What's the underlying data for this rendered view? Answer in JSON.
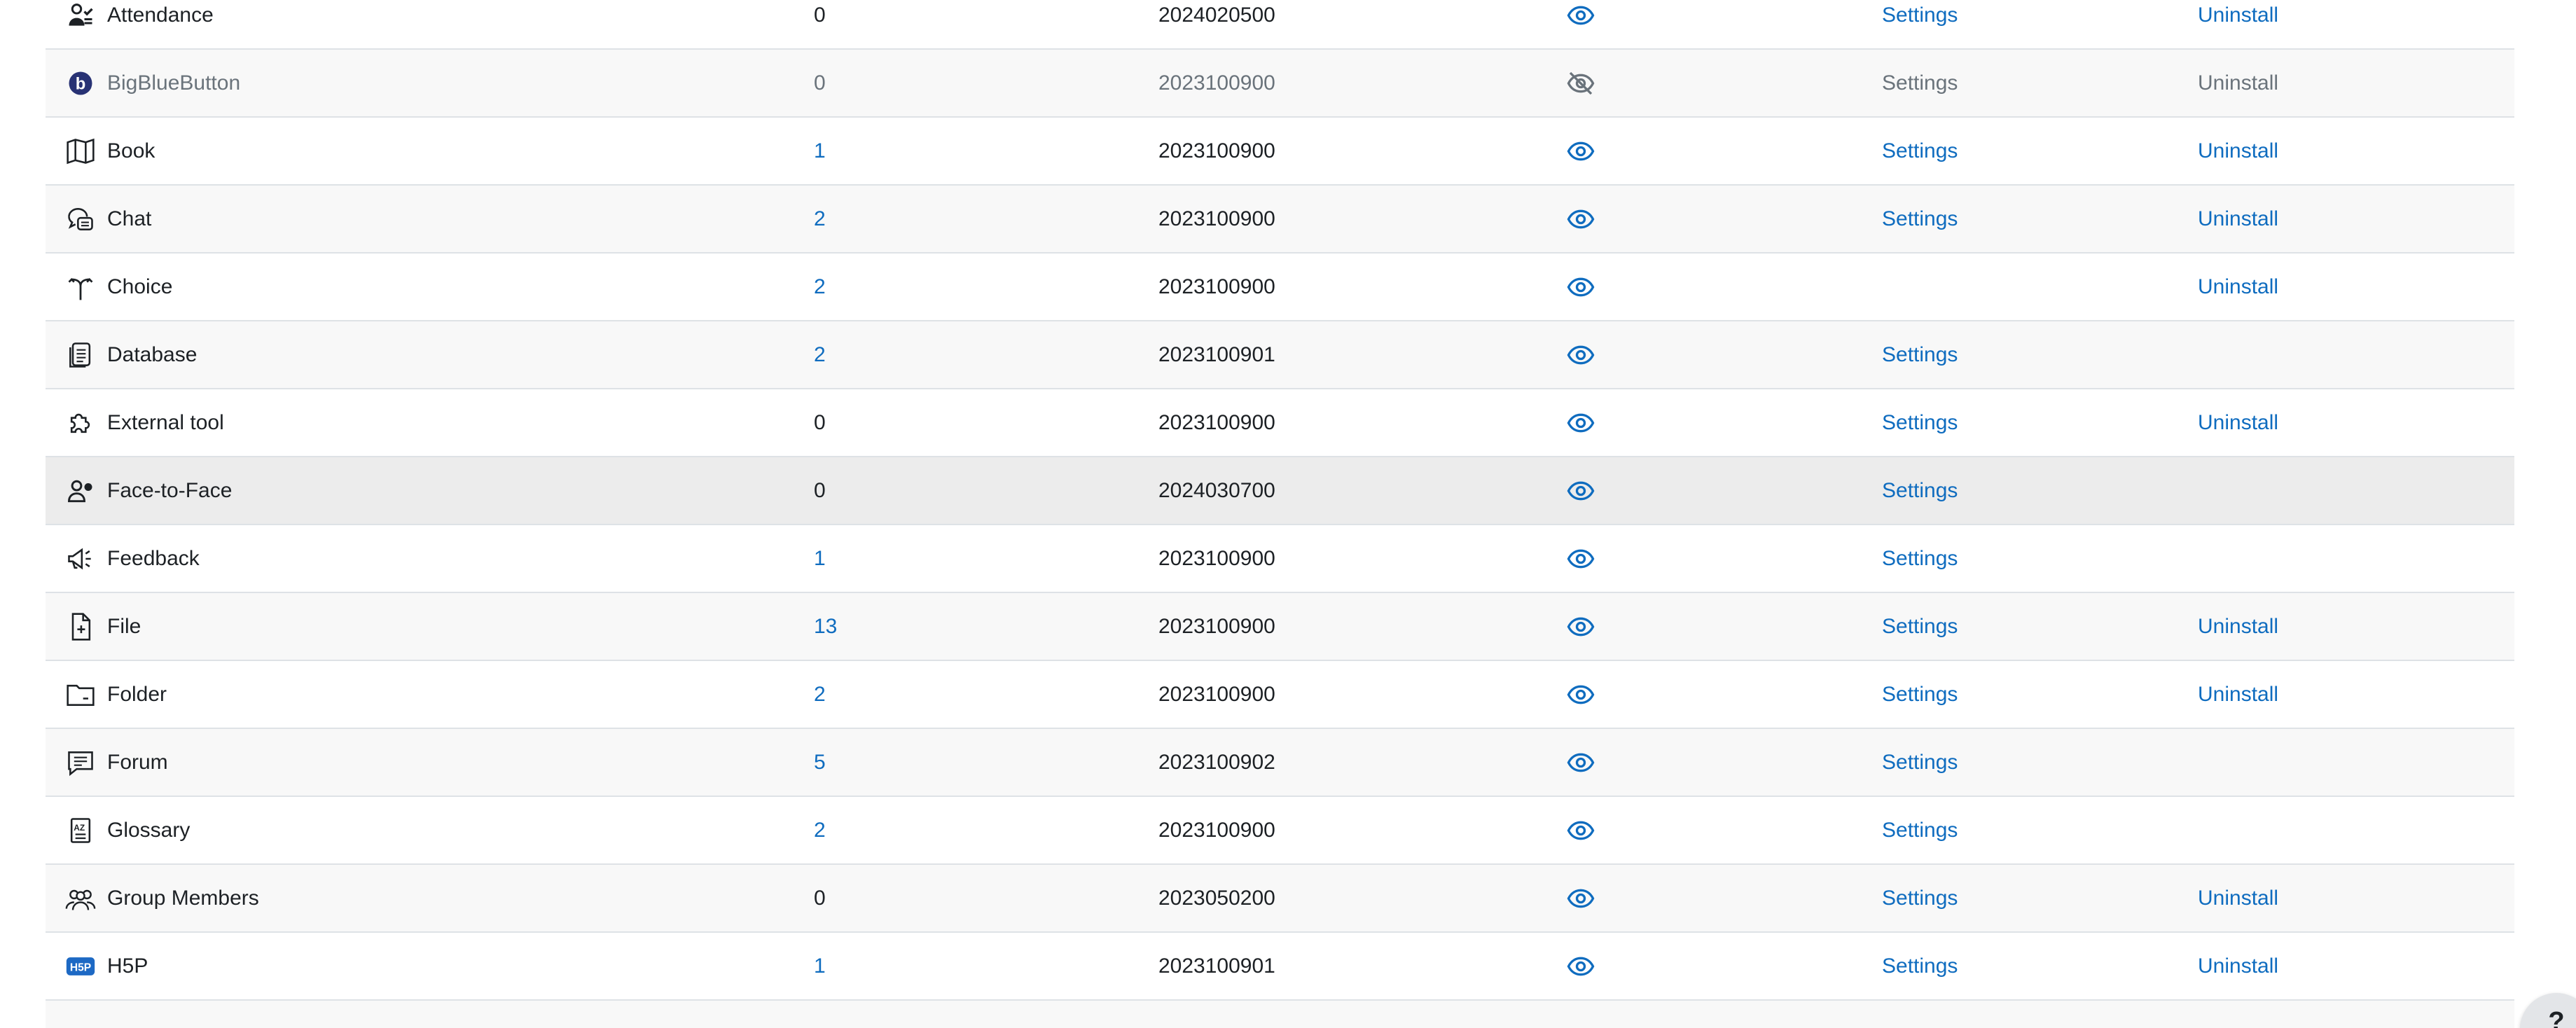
{
  "columns": {
    "settings_label": "Settings",
    "uninstall_label": "Uninstall"
  },
  "modules": [
    {
      "name": "Attendance",
      "icon": "attendance-icon",
      "count": "0",
      "count_link": false,
      "version": "2024020500",
      "visibility": "visible",
      "has_settings": true,
      "has_uninstall": true,
      "state": "normal"
    },
    {
      "name": "BigBlueButton",
      "icon": "bigbluebutton-icon",
      "count": "0",
      "count_link": true,
      "version": "2023100900",
      "visibility": "hidden",
      "has_settings": true,
      "has_uninstall": true,
      "state": "disabled"
    },
    {
      "name": "Book",
      "icon": "book-icon",
      "count": "1",
      "count_link": true,
      "version": "2023100900",
      "visibility": "visible",
      "has_settings": true,
      "has_uninstall": true,
      "state": "normal"
    },
    {
      "name": "Chat",
      "icon": "chat-icon",
      "count": "2",
      "count_link": true,
      "version": "2023100900",
      "visibility": "visible",
      "has_settings": true,
      "has_uninstall": true,
      "state": "normal"
    },
    {
      "name": "Choice",
      "icon": "choice-icon",
      "count": "2",
      "count_link": true,
      "version": "2023100900",
      "visibility": "visible",
      "has_settings": false,
      "has_uninstall": true,
      "state": "normal"
    },
    {
      "name": "Database",
      "icon": "database-icon",
      "count": "2",
      "count_link": true,
      "version": "2023100901",
      "visibility": "visible",
      "has_settings": true,
      "has_uninstall": false,
      "state": "normal"
    },
    {
      "name": "External tool",
      "icon": "puzzle-icon",
      "count": "0",
      "count_link": false,
      "version": "2023100900",
      "visibility": "visible",
      "has_settings": true,
      "has_uninstall": true,
      "state": "normal"
    },
    {
      "name": "Face-to-Face",
      "icon": "face-to-face-icon",
      "count": "0",
      "count_link": false,
      "version": "2024030700",
      "visibility": "visible",
      "has_settings": true,
      "has_uninstall": false,
      "state": "hover"
    },
    {
      "name": "Feedback",
      "icon": "megaphone-icon",
      "count": "1",
      "count_link": true,
      "version": "2023100900",
      "visibility": "visible",
      "has_settings": true,
      "has_uninstall": false,
      "state": "normal"
    },
    {
      "name": "File",
      "icon": "file-icon",
      "count": "13",
      "count_link": true,
      "version": "2023100900",
      "visibility": "visible",
      "has_settings": true,
      "has_uninstall": true,
      "state": "normal"
    },
    {
      "name": "Folder",
      "icon": "folder-icon",
      "count": "2",
      "count_link": true,
      "version": "2023100900",
      "visibility": "visible",
      "has_settings": true,
      "has_uninstall": true,
      "state": "normal"
    },
    {
      "name": "Forum",
      "icon": "forum-icon",
      "count": "5",
      "count_link": true,
      "version": "2023100902",
      "visibility": "visible",
      "has_settings": true,
      "has_uninstall": false,
      "state": "normal"
    },
    {
      "name": "Glossary",
      "icon": "glossary-icon",
      "count": "2",
      "count_link": true,
      "version": "2023100900",
      "visibility": "visible",
      "has_settings": true,
      "has_uninstall": false,
      "state": "normal"
    },
    {
      "name": "Group Members",
      "icon": "group-members-icon",
      "count": "0",
      "count_link": false,
      "version": "2023050200",
      "visibility": "visible",
      "has_settings": true,
      "has_uninstall": true,
      "state": "normal"
    },
    {
      "name": "H5P",
      "icon": "h5p-icon",
      "count": "1",
      "count_link": true,
      "version": "2023100901",
      "visibility": "visible",
      "has_settings": true,
      "has_uninstall": true,
      "state": "normal"
    },
    {
      "name": "",
      "icon": "",
      "count": "",
      "count_link": false,
      "version": "",
      "visibility": "",
      "has_settings": false,
      "has_uninstall": false,
      "state": "normal"
    }
  ],
  "help_button": {
    "label": "?"
  },
  "colors": {
    "link": "#0f6cbf",
    "text": "#1d2125",
    "muted": "#6a737b",
    "row_alt": "#f8f8f8",
    "row_hover": "#ececec",
    "border": "#dee2e6"
  }
}
